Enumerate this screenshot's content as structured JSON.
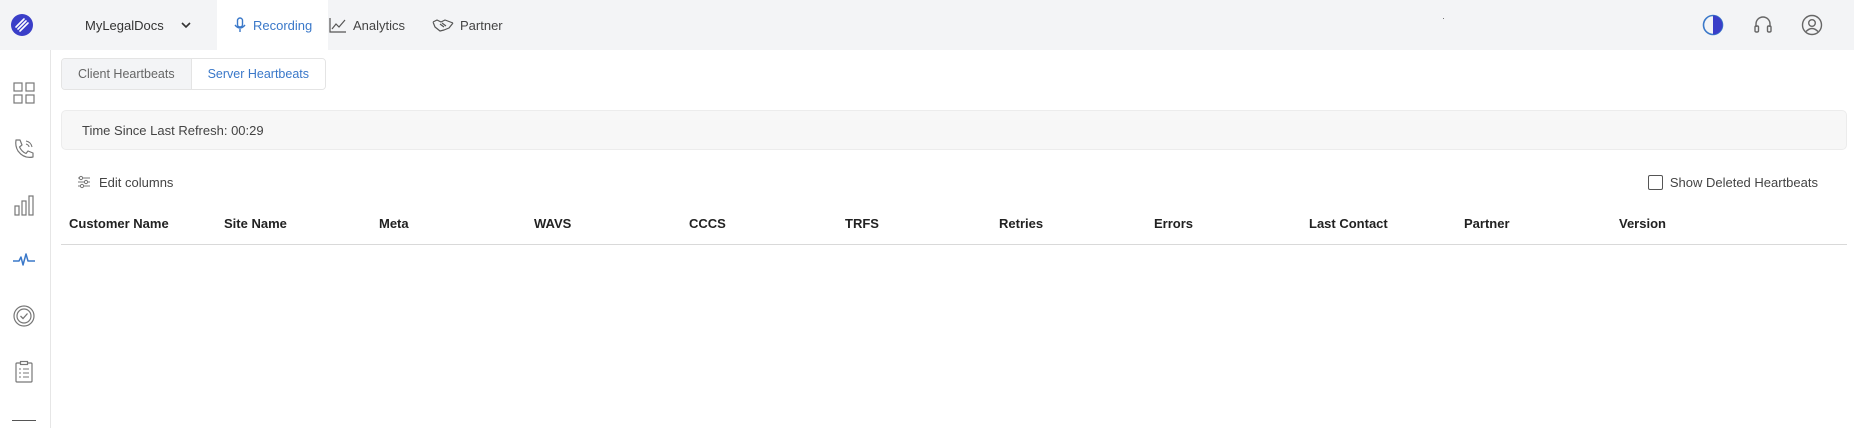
{
  "header": {
    "app_name": "MyLegalDocs",
    "nav": [
      {
        "label": "Recording",
        "icon": "microphone-icon",
        "active": true
      },
      {
        "label": "Analytics",
        "icon": "chart-line-icon",
        "active": false
      },
      {
        "label": "Partner",
        "icon": "handshake-icon",
        "active": false
      }
    ],
    "right_icons": [
      "contrast-icon",
      "headset-icon",
      "user-icon"
    ]
  },
  "sidebar": {
    "items": [
      "dashboard-grid-icon",
      "phone-icon",
      "bar-chart-icon",
      "heartbeat-icon",
      "check-circle-icon",
      "clipboard-list-icon"
    ],
    "active": "heartbeat-icon"
  },
  "subtabs": [
    {
      "label": "Client Heartbeats",
      "active": false
    },
    {
      "label": "Server Heartbeats",
      "active": true
    }
  ],
  "refresh": {
    "text": "Time Since Last Refresh: 00:29"
  },
  "toolbar": {
    "edit_columns": "Edit columns",
    "show_deleted": "Show Deleted Heartbeats",
    "show_deleted_checked": false
  },
  "table": {
    "columns": [
      "Customer Name",
      "Site Name",
      "Meta",
      "WAVS",
      "CCCS",
      "TRFS",
      "Retries",
      "Errors",
      "Last Contact",
      "Partner",
      "Version"
    ],
    "rows": []
  },
  "colors": {
    "accent": "#3a78c9",
    "topbar_bg": "#f3f4f6",
    "logo": "#3a3ec8"
  }
}
